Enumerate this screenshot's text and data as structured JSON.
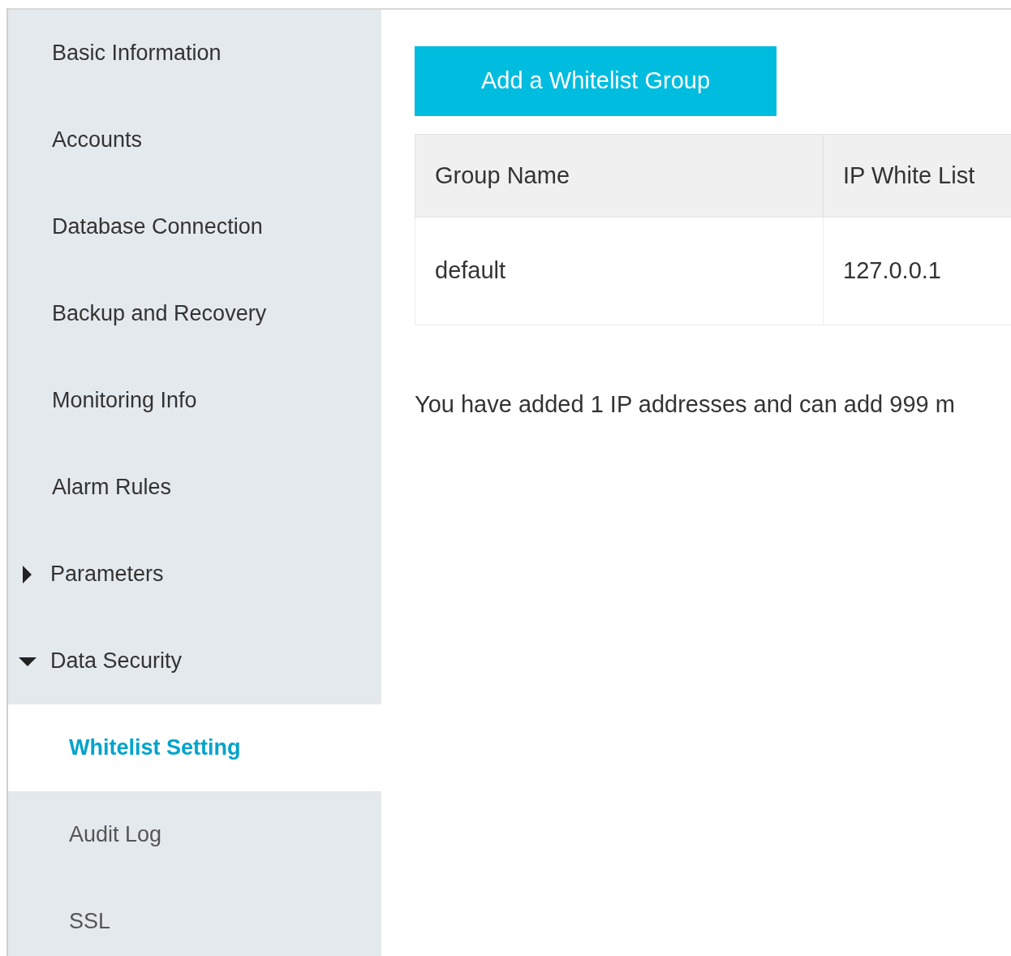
{
  "sidebar": {
    "items": [
      {
        "label": "Basic Information",
        "selected": false
      },
      {
        "label": "Accounts",
        "selected": false
      },
      {
        "label": "Database Connection",
        "selected": false
      },
      {
        "label": "Backup and Recovery",
        "selected": false
      },
      {
        "label": "Monitoring Info",
        "selected": false
      },
      {
        "label": "Alarm Rules",
        "selected": false
      },
      {
        "label": "Parameters",
        "selected": false,
        "expanded": false
      },
      {
        "label": "Data Security",
        "selected": false,
        "expanded": true,
        "children": [
          {
            "label": "Whitelist Setting",
            "selected": true
          },
          {
            "label": "Audit Log",
            "selected": false
          },
          {
            "label": "SSL",
            "selected": false
          }
        ]
      }
    ]
  },
  "add_button": "Add a Whitelist Group",
  "table": {
    "columns": [
      "Group Name",
      "IP White List"
    ],
    "rows": [
      [
        "default",
        "127.0.0.1"
      ]
    ]
  },
  "summary": "You have added 1 IP addresses and can add 999 m"
}
